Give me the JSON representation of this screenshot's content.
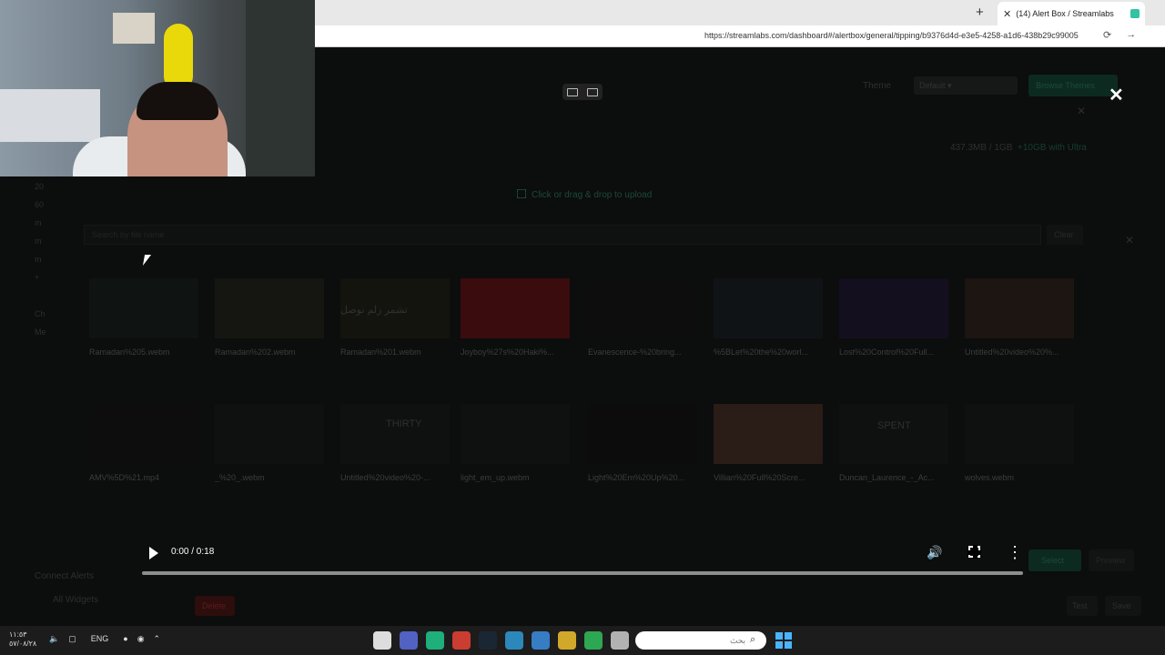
{
  "browser": {
    "tab_title": "(14) Alert Box / Streamlabs",
    "url": "https://streamlabs.com/dashboard#/alertbox/general/tipping/b9376d4d-e3e5-4258-a1d6-438b29c99005"
  },
  "header": {
    "theme_label": "Theme",
    "theme_value": "Default",
    "browse_label": "Browse Themes"
  },
  "storage": {
    "used": "437.3MB / 1GB",
    "upsell": "+10GB with Ultra"
  },
  "upload": {
    "label": "Click or drag & drop to upload"
  },
  "search": {
    "placeholder": "Search by file name",
    "clear_label": "Clear"
  },
  "left_nav": [
    "20",
    "60",
    "m",
    "m",
    "m",
    "+",
    "",
    "Ch",
    "Me"
  ],
  "gallery": {
    "items": [
      {
        "label": "Ramadan%205.webm",
        "color": "#0f1311"
      },
      {
        "label": "Ramadan%202.webm",
        "color": "#151611"
      },
      {
        "label": "Ramadan%201.webm",
        "color": "#14140f"
      },
      {
        "label": "Joyboy%27s%20Haki%...",
        "color": "#3a0c0d"
      },
      {
        "label": "Evanescence-%20bring...",
        "color": "#0d0d0d"
      },
      {
        "label": "%5BLet%20the%20worl...",
        "color": "#101316"
      },
      {
        "label": "Lost%20Control%20Full...",
        "color": "#140f1e"
      },
      {
        "label": "Untitled%20video%20%...",
        "color": "#1d1512"
      },
      {
        "label": "AMV%5D%21.mp4",
        "color": "#0d0d0d"
      },
      {
        "label": "_%20_.webm",
        "color": "#0f1010"
      },
      {
        "label": "Untitled%20video%20-...",
        "color": "#0f1010"
      },
      {
        "label": "light_em_up.webm",
        "color": "#0f1010"
      },
      {
        "label": "Light%20Em%20Up%20...",
        "color": "#0c0c0c"
      },
      {
        "label": "Villian%20Full%20Scre...",
        "color": "#2a1c16"
      },
      {
        "label": "Duncan_Laurence_-_Ac...",
        "color": "#0f1010"
      },
      {
        "label": "wolves.webm",
        "color": "#0f1010"
      }
    ],
    "thumb_text": [
      "تشمر زلم نوصل",
      "THIRTY",
      "SPENT"
    ]
  },
  "bottom": {
    "connect_label": "Connect Alerts",
    "all_widgets_label": "All Widgets",
    "delete_label": "Delete",
    "select_label": "Select",
    "preview_label": "Preview",
    "test_label": "Test",
    "save_label": "Save"
  },
  "video": {
    "time": "0:00 / 0:18",
    "progress": 0.0
  },
  "taskbar": {
    "clock": [
      "١١:٥٣",
      "٥٧/٠٨/٢٨"
    ],
    "lang": "ENG",
    "search_placeholder": "بحث",
    "app_colors": [
      "#ffffff",
      "#5b6ee1",
      "#1ec98b",
      "#ea4335",
      "#1b2838",
      "#2f9bd6",
      "#3b8ee0",
      "#f2c12e",
      "#30c05a",
      "#cccccc"
    ]
  }
}
